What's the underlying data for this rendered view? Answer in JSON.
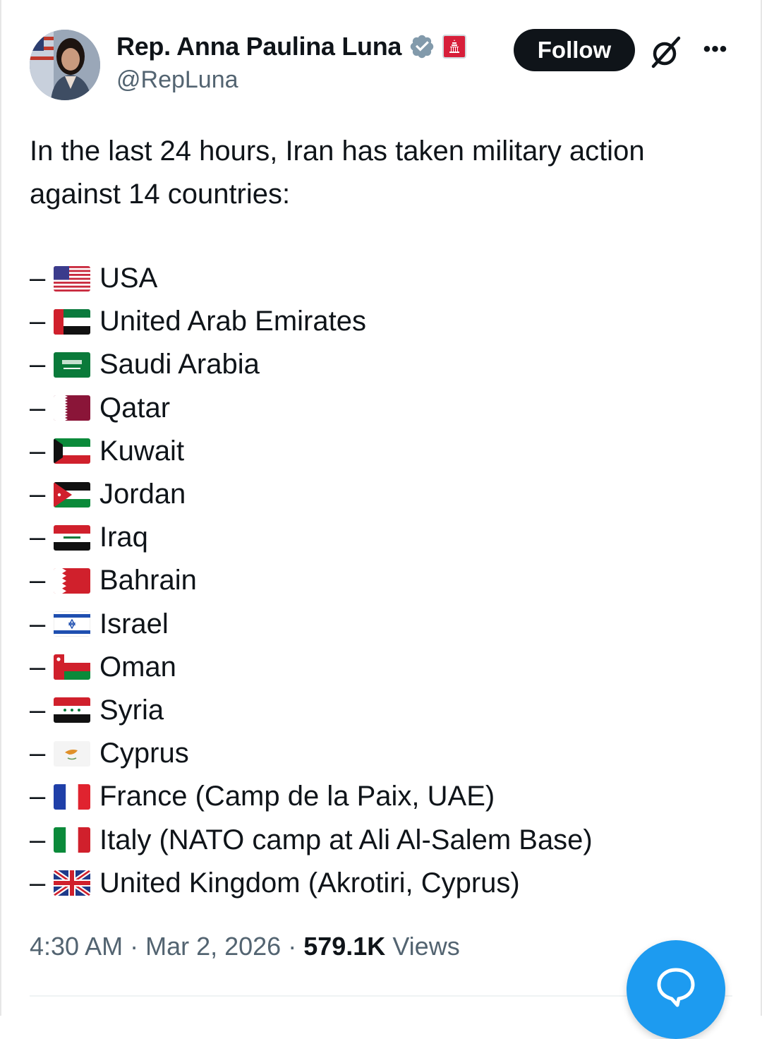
{
  "author": {
    "display_name": "Rep. Anna Paulina Luna",
    "handle": "@RepLuna",
    "avatar_icon": "profile-photo",
    "verified_icon": "verified-badge-icon",
    "affiliation_icon": "us-capitol-badge-icon"
  },
  "actions": {
    "follow_label": "Follow",
    "grok_icon": "grok-icon",
    "more_icon": "more-options-icon"
  },
  "tweet": {
    "intro": "In the last 24 hours, Iran has taken military action against 14 countries:",
    "dash": "–",
    "items": [
      {
        "flag": "us",
        "label": "USA"
      },
      {
        "flag": "ae",
        "label": "United Arab Emirates"
      },
      {
        "flag": "sa",
        "label": "Saudi Arabia"
      },
      {
        "flag": "qa",
        "label": "Qatar"
      },
      {
        "flag": "kw",
        "label": "Kuwait"
      },
      {
        "flag": "jo",
        "label": "Jordan"
      },
      {
        "flag": "iq",
        "label": "Iraq"
      },
      {
        "flag": "bh",
        "label": "Bahrain"
      },
      {
        "flag": "il",
        "label": "Israel"
      },
      {
        "flag": "om",
        "label": "Oman"
      },
      {
        "flag": "sy",
        "label": "Syria"
      },
      {
        "flag": "cy",
        "label": "Cyprus"
      },
      {
        "flag": "fr",
        "label": "France (Camp de la Paix, UAE)"
      },
      {
        "flag": "it",
        "label": "Italy (NATO camp at Ali Al-Salem Base)"
      },
      {
        "flag": "gb",
        "label": "United Kingdom (Akrotiri, Cyprus)"
      }
    ]
  },
  "meta": {
    "time": "4:30 AM",
    "sep1": " · ",
    "date": "Mar 2, 2026",
    "sep2": " · ",
    "views_count": "579.1K",
    "views_label": " Views"
  },
  "fab": {
    "icon": "reply-bubble-icon"
  },
  "colors": {
    "text": "#0f1419",
    "secondary": "#536471",
    "accent": "#1d9bf0",
    "verified": "#829aab",
    "affiliation": "#d71f3a"
  }
}
